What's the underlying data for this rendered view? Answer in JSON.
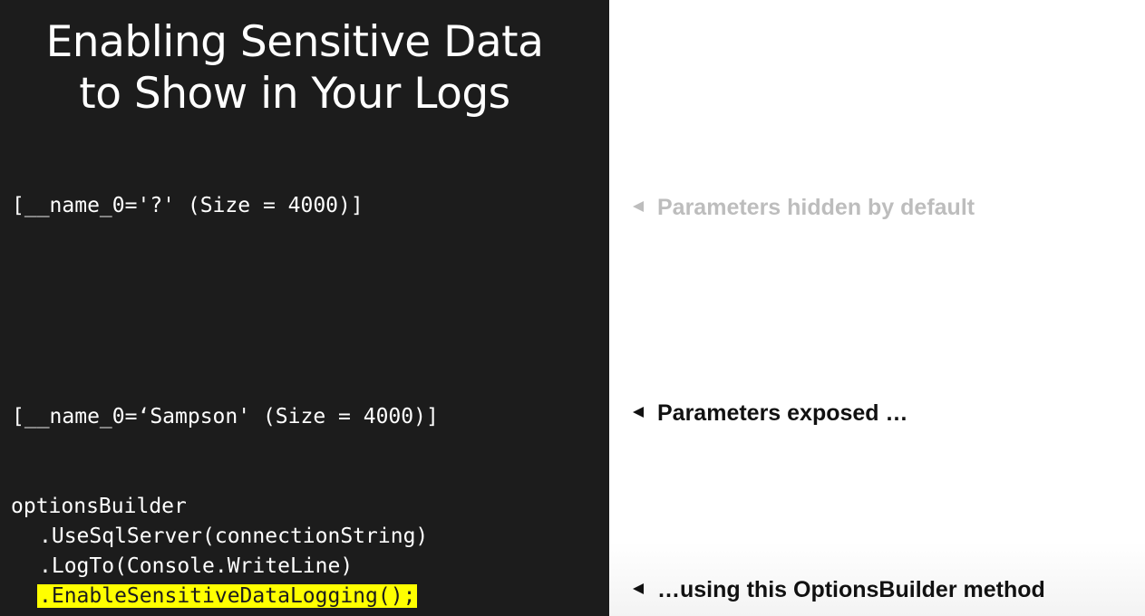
{
  "slide": {
    "title_line1": "Enabling Sensitive Data",
    "title_line2": "to Show in Your Logs"
  },
  "code": {
    "hidden_params": "[__name_0='?' (Size = 4000)]",
    "exposed_params": "[__name_0=‘Sampson' (Size = 4000)]",
    "builder_lines": [
      "optionsBuilder",
      ".UseSqlServer(connectionString)",
      ".LogTo(Console.WriteLine)"
    ],
    "highlighted_line": ".EnableSensitiveDataLogging();"
  },
  "notes": {
    "hidden": "Parameters hidden by default",
    "exposed": "Parameters exposed …",
    "method": "…using this OptionsBuilder method"
  },
  "colors": {
    "dark_panel": "#1c1c1c",
    "highlight": "#ffff00",
    "muted_note": "#bdbdbd",
    "strong_note": "#111111"
  },
  "icons": {
    "note_marker": "left-pointing-triangle"
  }
}
